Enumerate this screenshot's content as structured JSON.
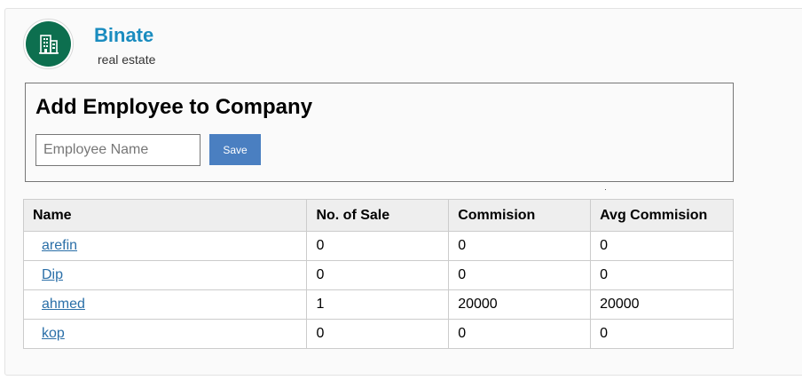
{
  "company": {
    "name": "Binate",
    "type": "real estate",
    "icon": "building-icon",
    "brand_color": "#1a8cbf",
    "logo_color": "#0d6f4f"
  },
  "add_employee": {
    "title": "Add Employee to Company",
    "input_placeholder": "Employee Name",
    "input_value": "",
    "save_label": "Save",
    "save_color": "#4a7fc1"
  },
  "table": {
    "headers": [
      "Name",
      "No. of Sale",
      "Commision",
      "Avg Commision"
    ],
    "rows": [
      {
        "name": "arefin",
        "sales": "0",
        "commision": "0",
        "avg_commision": "0"
      },
      {
        "name": "Dip",
        "sales": "0",
        "commision": "0",
        "avg_commision": "0"
      },
      {
        "name": "ahmed",
        "sales": "1",
        "commision": "20000",
        "avg_commision": "20000"
      },
      {
        "name": "kop",
        "sales": "0",
        "commision": "0",
        "avg_commision": "0"
      }
    ]
  }
}
